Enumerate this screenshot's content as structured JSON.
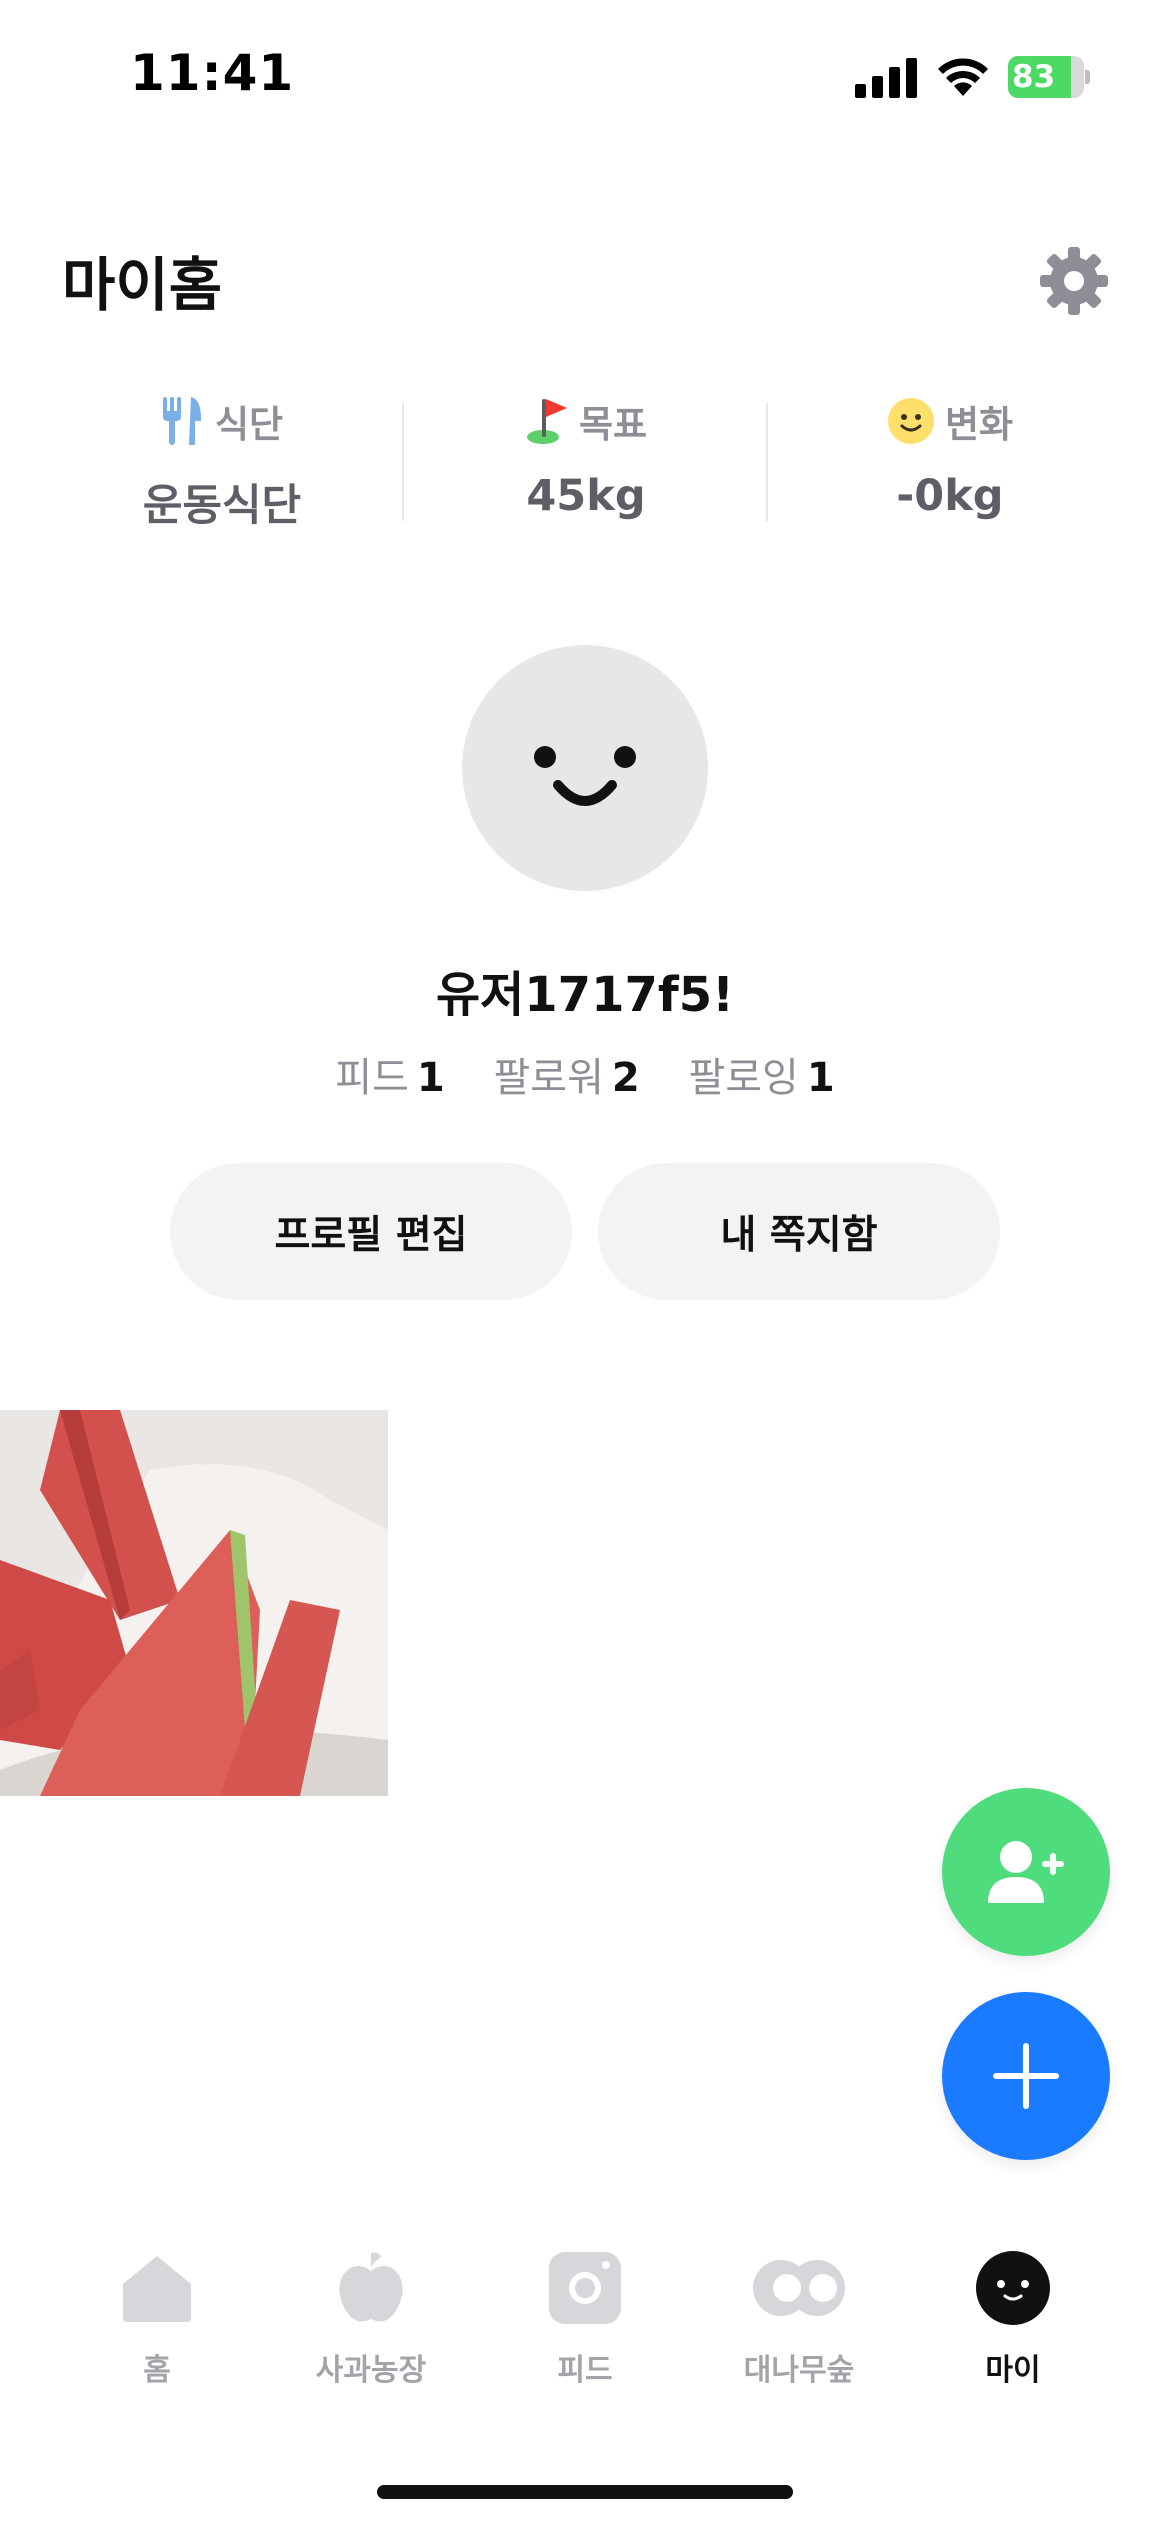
{
  "status_bar": {
    "time": "11:41",
    "battery": "83",
    "battery_level": 0.83
  },
  "header": {
    "title": "마이홈",
    "settings_icon": "gear-icon"
  },
  "stats": [
    {
      "icon": "fork-knife-icon",
      "label": "식단",
      "value": "운동식단"
    },
    {
      "icon": "flag-icon",
      "label": "목표",
      "value": "45kg"
    },
    {
      "icon": "smile-emoji-icon",
      "label": "변화",
      "value": "-0kg"
    }
  ],
  "profile": {
    "username": "유저1717f5!",
    "feed_label": "피드",
    "feed_count": "1",
    "followers_label": "팔로워",
    "followers_count": "2",
    "following_label": "팔로잉",
    "following_count": "1"
  },
  "buttons": {
    "edit_profile": "프로필 편집",
    "messages": "내 쪽지함"
  },
  "feed": {
    "thumbnail_icon": "watermelon-photo"
  },
  "fabs": {
    "add_friend_icon": "add-person-icon",
    "create_icon": "plus-icon"
  },
  "bottom_nav": [
    {
      "label": "홈",
      "icon": "home-icon"
    },
    {
      "label": "사과농장",
      "icon": "apple-icon"
    },
    {
      "label": "피드",
      "icon": "camera-icon"
    },
    {
      "label": "대나무숲",
      "icon": "eyes-icon"
    },
    {
      "label": "마이",
      "icon": "my-face-icon",
      "active": true
    }
  ],
  "colors": {
    "accent_blue": "#1a7bff",
    "accent_green": "#4fdc7c",
    "battery_green": "#4cd964"
  }
}
